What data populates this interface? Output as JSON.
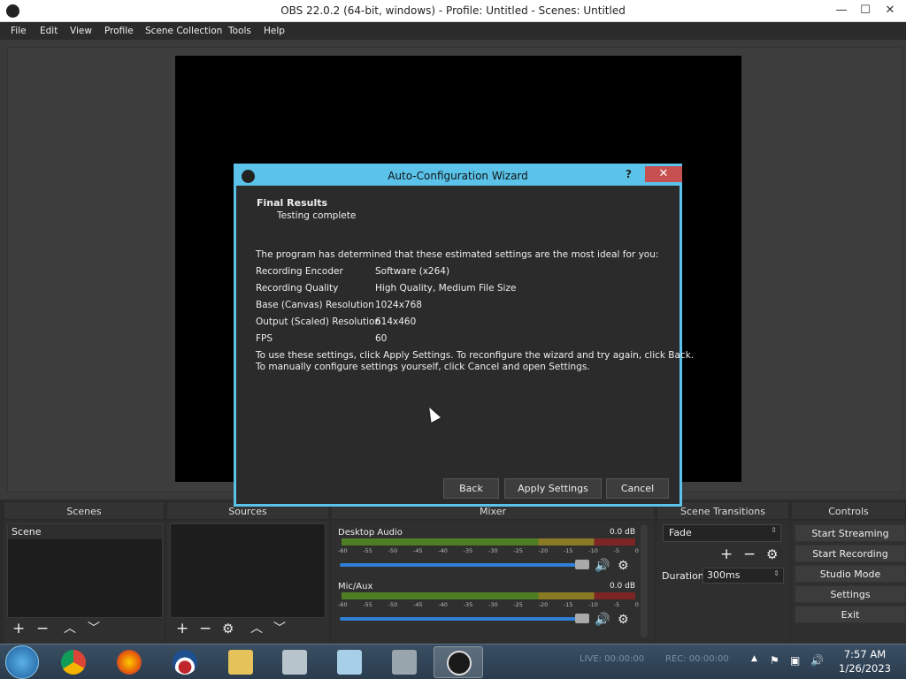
{
  "window": {
    "title": "OBS 22.0.2 (64-bit, windows) - Profile: Untitled - Scenes: Untitled",
    "minimize": "—",
    "maximize": "☐",
    "close": "✕"
  },
  "menu": [
    "File",
    "Edit",
    "View",
    "Profile",
    "Scene Collection",
    "Tools",
    "Help"
  ],
  "docks": {
    "scenes": "Scenes",
    "sources": "Sources",
    "mixer": "Mixer",
    "transitions": "Scene Transitions",
    "controls": "Controls"
  },
  "scenes": {
    "items": [
      "Scene"
    ]
  },
  "mixer": {
    "ticks": [
      "-60",
      "-55",
      "-50",
      "-45",
      "-40",
      "-35",
      "-30",
      "-25",
      "-20",
      "-15",
      "-10",
      "-5",
      "0"
    ],
    "channels": [
      {
        "name": "Desktop Audio",
        "db": "0.0 dB",
        "volume": 0.95
      },
      {
        "name": "Mic/Aux",
        "db": "0.0 dB",
        "volume": 0.95
      }
    ]
  },
  "transitions": {
    "selected": "Fade",
    "duration_label": "Duration",
    "duration_value": "300ms"
  },
  "controls": [
    "Start Streaming",
    "Start Recording",
    "Studio Mode",
    "Settings",
    "Exit"
  ],
  "dialog": {
    "title": "Auto-Configuration Wizard",
    "help": "?",
    "close": "✕",
    "heading": "Final Results",
    "subheading": "Testing complete",
    "intro": "The program has determined that these estimated settings are the most ideal for you:",
    "settings": [
      {
        "label": "Recording Encoder",
        "value": "Software (x264)"
      },
      {
        "label": "Recording Quality",
        "value": "High Quality, Medium File Size"
      },
      {
        "label": "Base (Canvas) Resolution",
        "value": "1024x768"
      },
      {
        "label": "Output (Scaled) Resolution",
        "value": "614x460"
      },
      {
        "label": "FPS",
        "value": "60"
      }
    ],
    "note1": "To use these settings, click Apply Settings.  To reconfigure the wizard and try again, click Back.",
    "note2": "To manually configure settings yourself, click Cancel and open Settings.",
    "buttons": {
      "back": "Back",
      "apply": "Apply Settings",
      "cancel": "Cancel"
    }
  },
  "status": {
    "live": "LIVE: 00:00:00",
    "rec": "REC: 00:00:00"
  },
  "clock": {
    "time": "7:57 AM",
    "date": "1/26/2023"
  },
  "taskbar": {
    "apps": [
      "chrome",
      "firefox",
      "obama-campaign",
      "file-explorer",
      "app-5",
      "notepad",
      "app-7",
      "obs"
    ]
  }
}
